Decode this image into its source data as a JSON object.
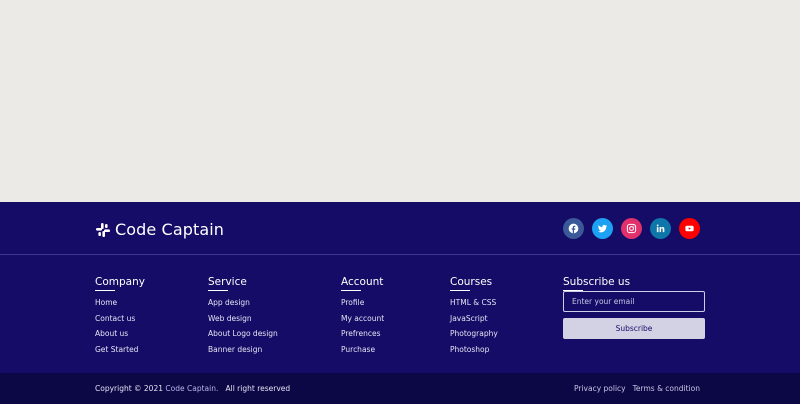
{
  "brand": {
    "name": "Code Captain",
    "icon": "slack-logo-icon"
  },
  "socials": [
    {
      "name": "facebook",
      "icon": "facebook-icon",
      "color": "#3b5998"
    },
    {
      "name": "twitter",
      "icon": "twitter-icon",
      "color": "#1da1f2"
    },
    {
      "name": "instagram",
      "icon": "instagram-icon",
      "color": "#e1306c"
    },
    {
      "name": "linkedin",
      "icon": "linkedin-icon",
      "color": "#0e76a8"
    },
    {
      "name": "youtube",
      "icon": "youtube-icon",
      "color": "#ff0000"
    }
  ],
  "columns": {
    "company": {
      "title": "Company",
      "items": [
        "Home",
        "Contact us",
        "About us",
        "Get Started"
      ]
    },
    "service": {
      "title": "Service",
      "items": [
        "App design",
        "Web design",
        "About Logo design",
        "Banner design"
      ]
    },
    "account": {
      "title": "Account",
      "items": [
        "Profile",
        "My account",
        "Prefrences",
        "Purchase"
      ]
    },
    "courses": {
      "title": "Courses",
      "items": [
        "HTML & CSS",
        "JavaScript",
        "Photography",
        "Photoshop"
      ]
    }
  },
  "subscribe": {
    "title": "Subscribe us",
    "placeholder": "Enter your email",
    "button_label": "Subscribe"
  },
  "bottom": {
    "copyright_prefix": "Copyright © 2021",
    "copyright_brand": "Code Captain.",
    "copyright_suffix": "All right reserved",
    "links": [
      "Privacy policy",
      "Terms & condition"
    ]
  },
  "colors": {
    "footer_bg": "#140c66",
    "bottom_bg": "#0c0745",
    "page_bg": "#ebeae7"
  }
}
